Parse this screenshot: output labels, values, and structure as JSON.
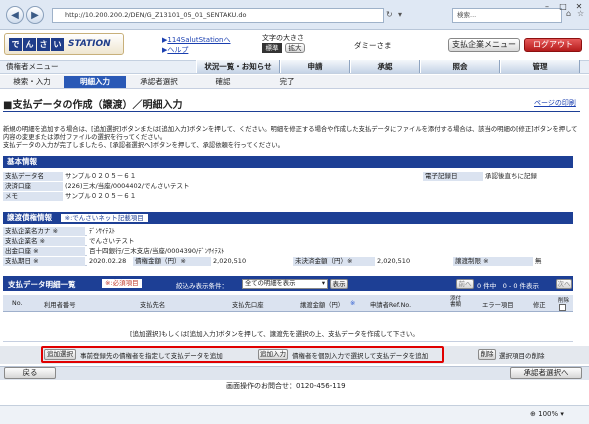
{
  "browser": {
    "url": "http://10.200.200.2/DEN/G_Z13101_05_01_SENTAKU.do",
    "search_placeholder": "検索...",
    "zoom": "100%"
  },
  "header": {
    "logo_chars": [
      "で",
      "ん",
      "さ",
      "い"
    ],
    "logo_station": "STATION",
    "link_salut": "114SalutStationへ",
    "link_help": "ヘルプ",
    "font_size_label": "文字の大きさ",
    "font_std": "標準",
    "font_large": "拡大",
    "user_name": "ダミーさま",
    "btn_payer_menu": "支払企業メニュー",
    "btn_logout": "ログアウト"
  },
  "menu": {
    "title": "債権者メニュー",
    "tabs": [
      "状況一覧・お知らせ",
      "申請",
      "承認",
      "照会",
      "管理"
    ]
  },
  "steps": [
    "検索・入力",
    "明細入力",
    "承認者選択",
    "確認",
    "完了"
  ],
  "page": {
    "title": "■支払データの作成（譲渡）／明細入力",
    "print_link": "ページの印刷",
    "instructions": "新規の明細を追加する場合は、[追加選択]ボタンまたは[追加入力]ボタンを押して、ください。明細を修正する場合や作成した支払データにファイルを添付する場合は、該当の明細の[修正]ボタンを押して内容の変更または添付ファイルの選択を行ってください。\n支払データの入力が完了しましたら、[承認者選択へ]ボタンを押して、承認依頼を行ってください。"
  },
  "basic_info": {
    "heading": "基本情報",
    "data_name_label": "支払データ名",
    "data_name_value": "サンプル０２０５－６１",
    "record_time_label": "電子記録日",
    "record_time_value": "承認後直ちに記録",
    "account_label": "決済口座",
    "account_value": "(226)三木/当座/0004402/でんさいテスト",
    "memo_label": "メモ",
    "memo_value": "サンプル０２０５－６１"
  },
  "transfer_info": {
    "heading": "譲渡債権情報",
    "heading_badge": "※:でんさいネット記載項目",
    "payer_kana_label": "支払企業名カナ ※",
    "payer_kana_value": "ﾃﾞﾝｻｲﾃｽﾄ",
    "payer_name_label": "支払企業名 ※",
    "payer_name_value": "でんさいテスト",
    "account_label": "出金口座 ※",
    "account_value": "百十四銀行/三木支店/当座/0004390/ﾃﾞﾝｻｲﾃｽﾄ",
    "due_label": "支払期日 ※",
    "due_value": "2020.02.28",
    "claim_amount_label": "債権金額（円）※",
    "claim_amount_value": "2,020,510",
    "unsettled_label": "未決済金額（円）※",
    "unsettled_value": "2,020,510",
    "restriction_label": "譲渡制限 ※",
    "restriction_value": "無"
  },
  "detail_list": {
    "heading": "支払データ明細一覧",
    "required_badge": "※:必須項目",
    "filter_label": "絞込み表示条件：",
    "filter_value": "全ての明細を表示",
    "filter_button": "表示",
    "prev_button": "前へ",
    "count_text": "0 件中　0 - 0 件表示",
    "next_button": "次へ",
    "columns": [
      "No.",
      "利用者番号",
      "支払先名",
      "支払先口座",
      "譲渡金額（円）",
      "※",
      "申請者Ref.No.",
      "添付書類",
      "エラー項目",
      "修正",
      "削除"
    ],
    "empty_message": "[追加選択]もしくは[追加入力]ボタンを押して、譲渡先を選択の上、支払データを作成して下さい。"
  },
  "actions": {
    "add_select_button": "追加選択",
    "add_select_desc": "事前登録先の債権者を指定して支払データを追加",
    "add_input_button": "追加入力",
    "add_input_desc": "債権者を個別入力で選択して支払データを追加",
    "delete_button": "削除",
    "delete_desc": "選択項目の削除"
  },
  "footer": {
    "back_button": "戻る",
    "next_button": "承認者選択へ",
    "contact": "画面操作のお問合せ：0120-456-119"
  }
}
